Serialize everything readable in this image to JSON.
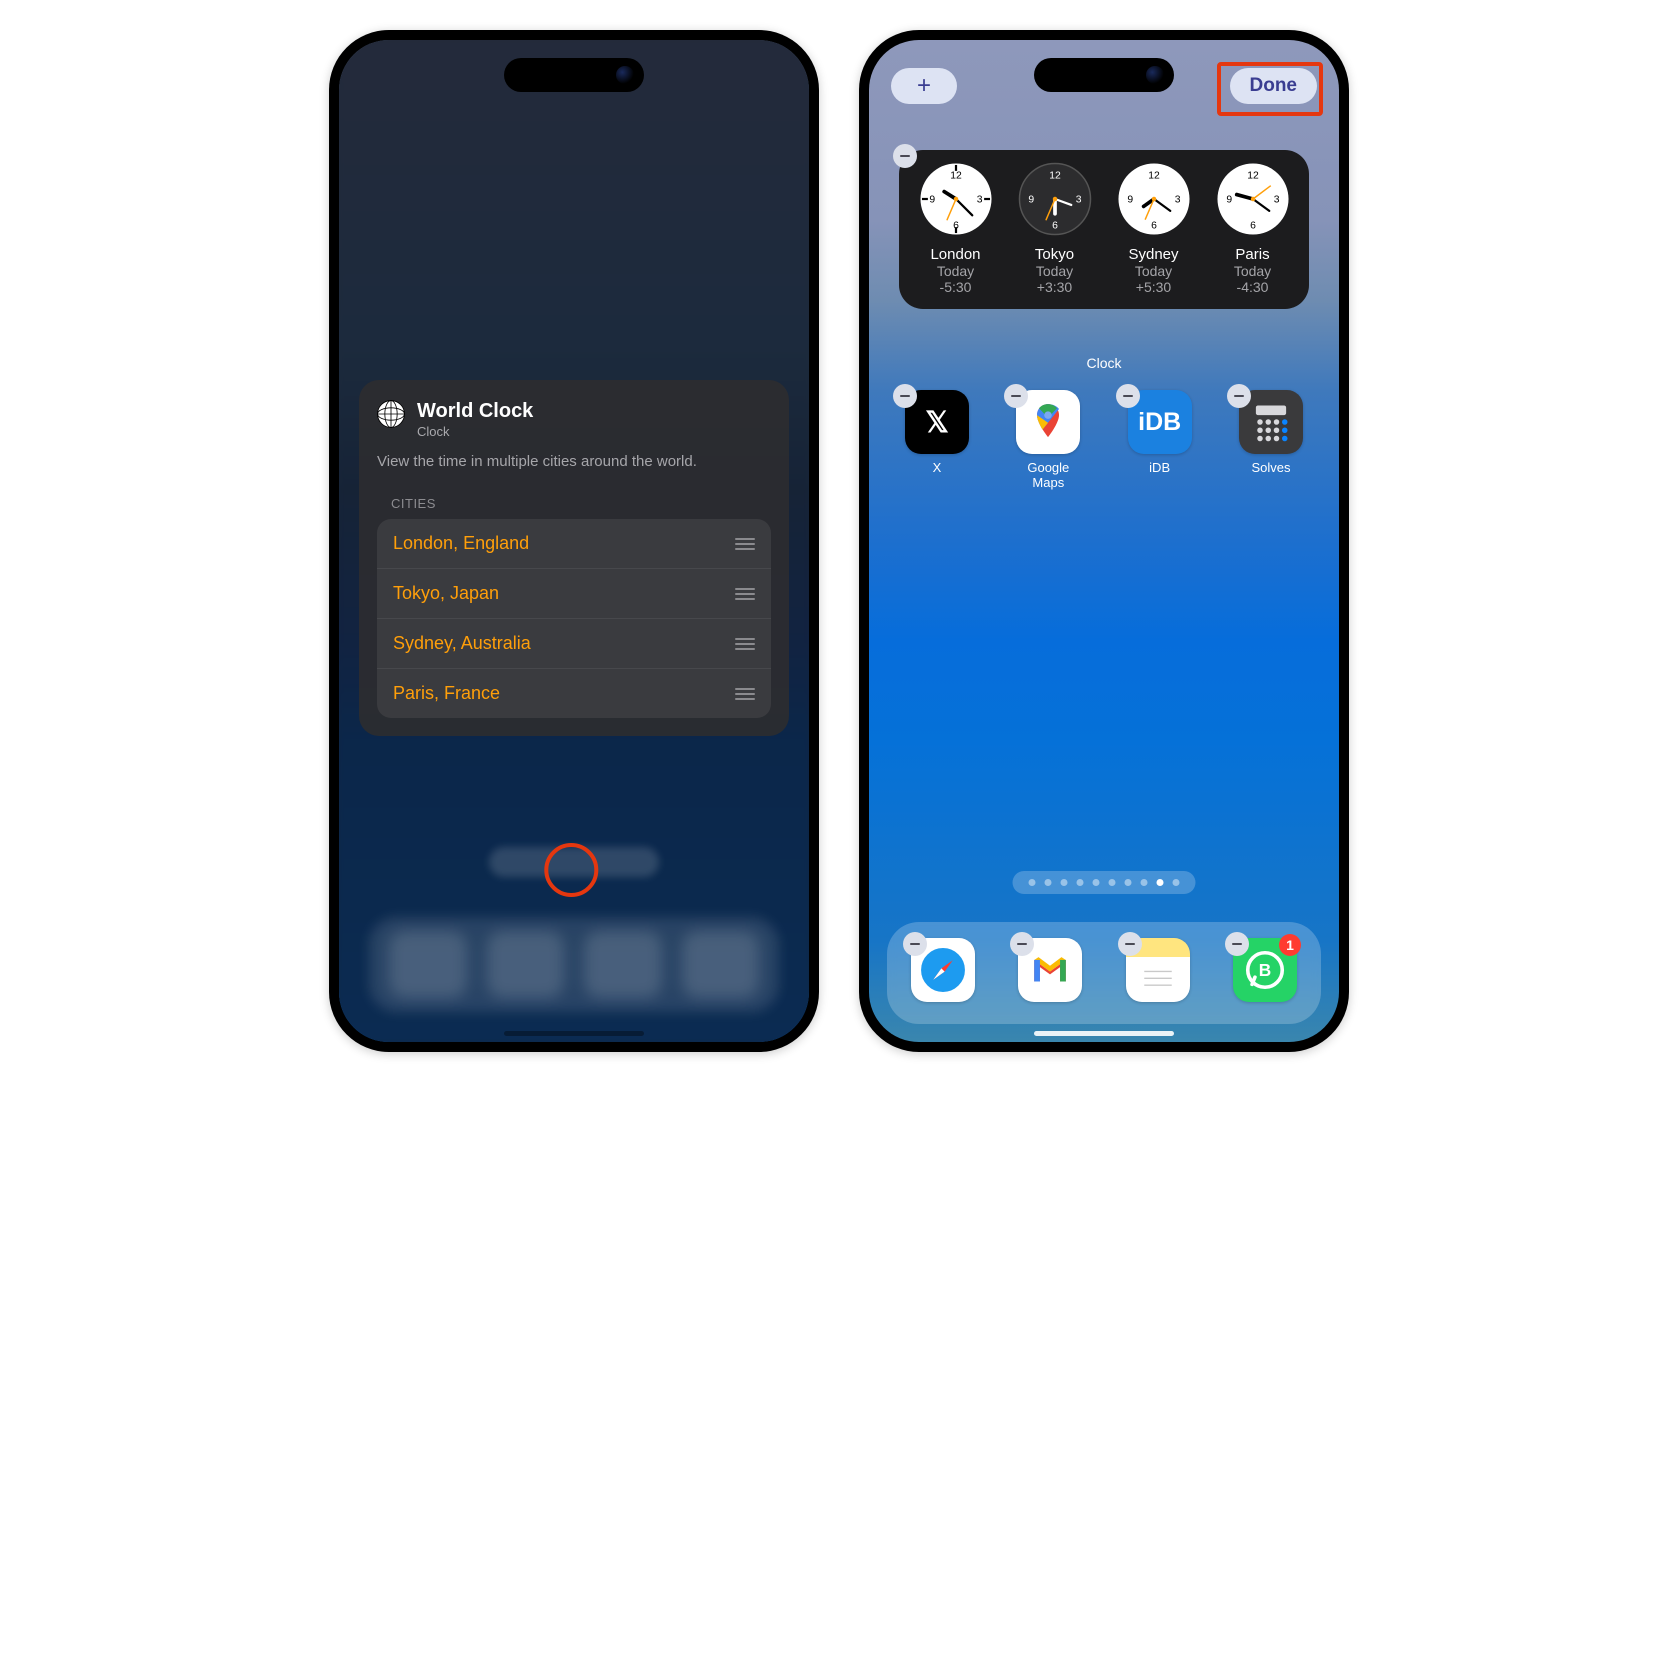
{
  "left": {
    "widget_title": "World Clock",
    "app_name": "Clock",
    "description": "View the time in multiple cities around the world.",
    "cities_heading": "CITIES",
    "cities": [
      "London, England",
      "Tokyo, Japan",
      "Sydney, Australia",
      "Paris, France"
    ]
  },
  "right": {
    "add_glyph": "+",
    "done_label": "Done",
    "widget_caption": "Clock",
    "clocks": [
      {
        "city": "London",
        "day": "Today",
        "offset": "-5:30",
        "dark": false
      },
      {
        "city": "Tokyo",
        "day": "Today",
        "offset": "+3:30",
        "dark": true
      },
      {
        "city": "Sydney",
        "day": "Today",
        "offset": "+5:30",
        "dark": false
      },
      {
        "city": "Paris",
        "day": "Today",
        "offset": "-4:30",
        "dark": false
      }
    ],
    "apps": [
      {
        "label": "X"
      },
      {
        "label": "Google Maps"
      },
      {
        "label": "iDB"
      },
      {
        "label": "Solves"
      }
    ],
    "dock_badge": "1",
    "page_count": 10,
    "active_page_index": 8
  }
}
